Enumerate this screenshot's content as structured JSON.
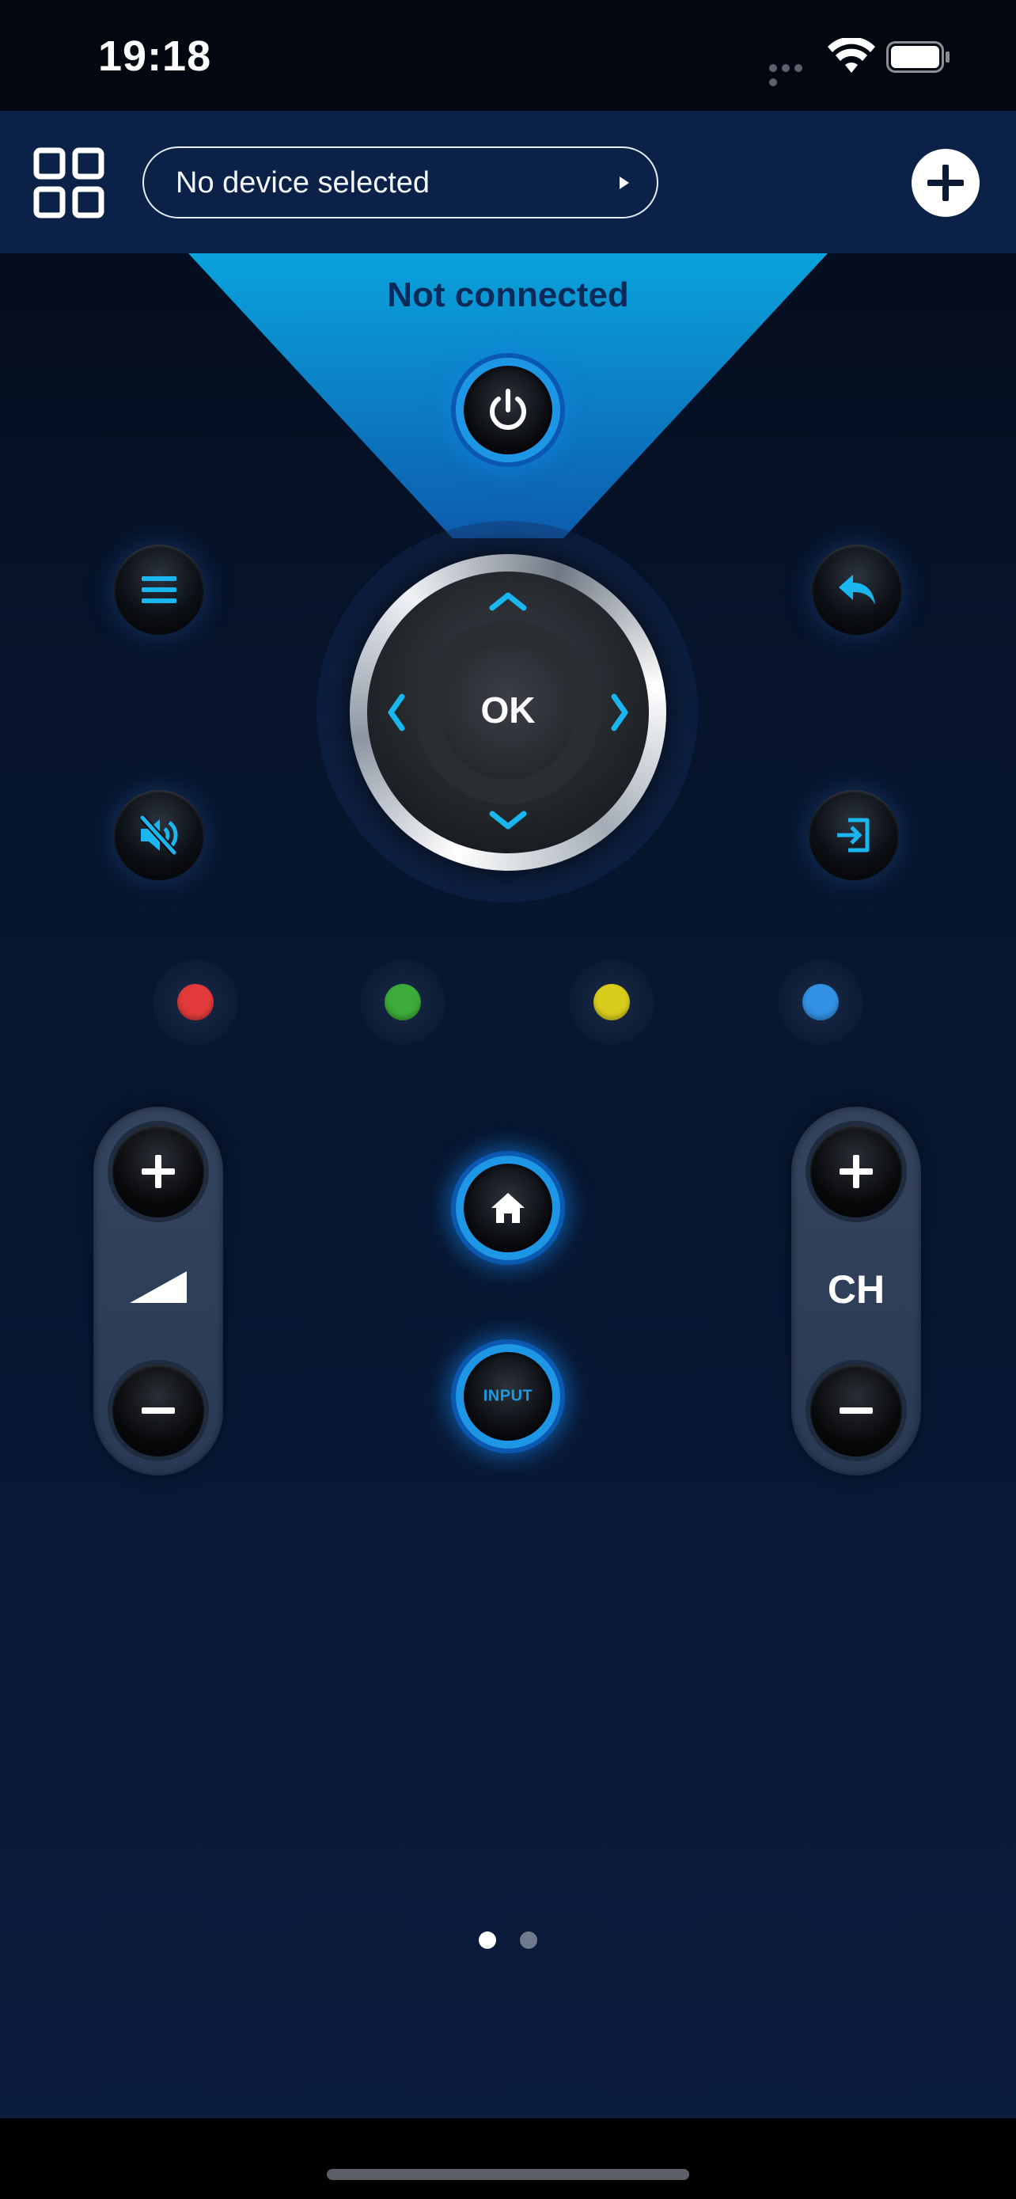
{
  "status_bar": {
    "time": "19:18",
    "icons": [
      "signal-dots-icon",
      "wifi-icon",
      "battery-icon"
    ]
  },
  "header": {
    "menu_icon": "grid-icon",
    "device_selector": {
      "label": "No device selected",
      "icon": "play-arrow-icon"
    },
    "add_button_icon": "plus-icon"
  },
  "connection": {
    "status": "Not connected",
    "beam_color": "#0aa0d8"
  },
  "remote": {
    "power_icon": "power-icon",
    "menu_icon": "hamburger-menu-icon",
    "back_icon": "back-arrow-icon",
    "mute_icon": "mute-icon",
    "source_icon": "input-source-icon",
    "dpad": {
      "ok_label": "OK",
      "arrows": [
        "up",
        "down",
        "left",
        "right"
      ]
    },
    "color_keys": [
      {
        "name": "red",
        "color": "#e23a3a"
      },
      {
        "name": "green",
        "color": "#3dab3a"
      },
      {
        "name": "yellow",
        "color": "#d8cd1b"
      },
      {
        "name": "blue",
        "color": "#3291e3"
      }
    ],
    "volume": {
      "icon": "volume-ramp-icon"
    },
    "channel": {
      "label": "CH"
    },
    "home_icon": "home-icon",
    "input_label": "INPUT"
  },
  "pager": {
    "pages": 2,
    "current": 1
  },
  "accent_color": "#1aaef0"
}
